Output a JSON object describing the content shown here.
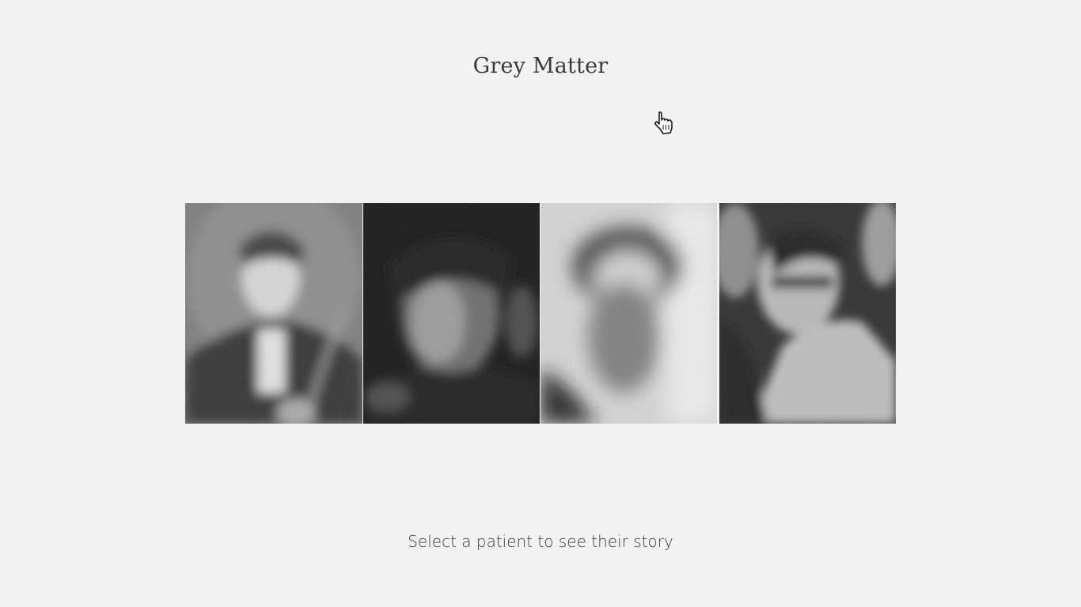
{
  "app": {
    "title": "Grey Matter"
  },
  "patients": [
    {
      "portrait": "blurred-portrait-man-with-violin"
    },
    {
      "portrait": "blurred-portrait-young-man-dark"
    },
    {
      "portrait": "blurred-portrait-faded-figure"
    },
    {
      "portrait": "blurred-portrait-man-with-glasses"
    }
  ],
  "instructions": {
    "text": "Select a patient to see their story"
  },
  "cursor": {
    "icon": "hand-pointer-icon"
  }
}
